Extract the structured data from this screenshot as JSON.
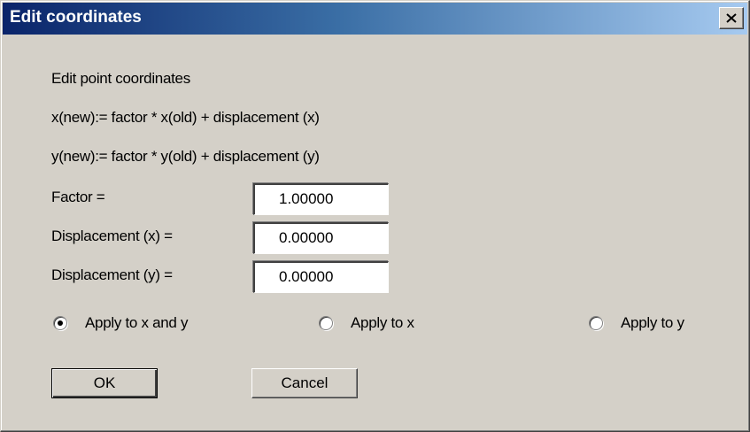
{
  "window": {
    "title": "Edit coordinates",
    "close_icon": "close-icon"
  },
  "content": {
    "heading": "Edit point coordinates",
    "formula_x": "x(new):= factor * x(old) + displacement (x)",
    "formula_y": "y(new):= factor * y(old) + displacement (y)"
  },
  "fields": {
    "factor": {
      "label": "Factor =",
      "value": "1.00000"
    },
    "displacement_x": {
      "label": "Displacement (x) =",
      "value": "0.00000"
    },
    "displacement_y": {
      "label": "Displacement (y) =",
      "value": "0.00000"
    }
  },
  "apply_options": {
    "selected": "Apply to x and y",
    "items": [
      "Apply to x and y",
      "Apply to x",
      "Apply to y"
    ]
  },
  "buttons": {
    "ok": "OK",
    "cancel": "Cancel"
  }
}
